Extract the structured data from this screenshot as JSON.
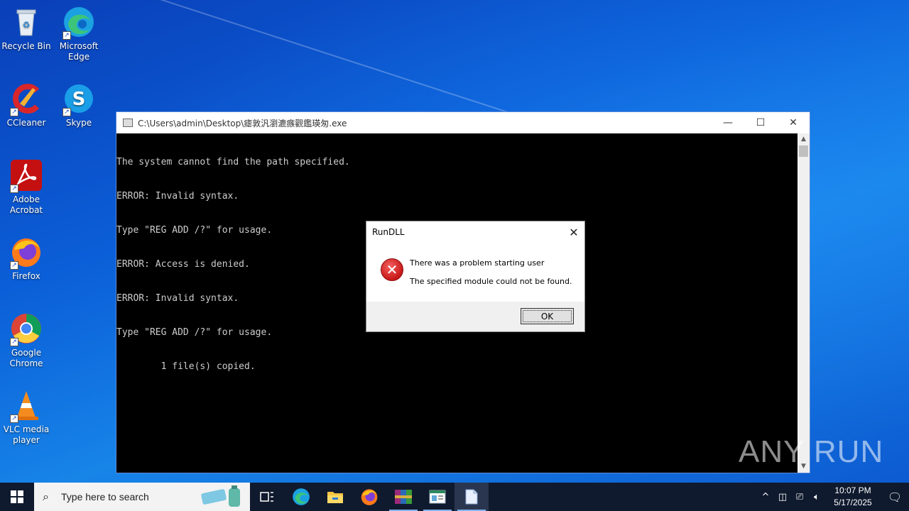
{
  "desktop": {
    "icons": [
      {
        "label": "Recycle Bin"
      },
      {
        "label": "Microsoft Edge"
      },
      {
        "label": "CCleaner"
      },
      {
        "label": "Skype"
      },
      {
        "label": "Adobe Acrobat"
      },
      {
        "label": "Firefox"
      },
      {
        "label": "Google Chrome"
      },
      {
        "label": "VLC media player"
      }
    ]
  },
  "console": {
    "title": "C:\\Users\\admin\\Desktop\\瘧敦汎瀏漉瘯觀鑑瑛匆.exe",
    "lines": [
      "The system cannot find the path specified.",
      "ERROR: Invalid syntax.",
      "Type \"REG ADD /?\" for usage.",
      "ERROR: Access is denied.",
      "ERROR: Invalid syntax.",
      "Type \"REG ADD /?\" for usage.",
      "        1 file(s) copied."
    ]
  },
  "dialog": {
    "title": "RunDLL",
    "message1": "There was a problem starting user",
    "message2": "The specified module could not be found.",
    "ok_label": "OK"
  },
  "watermark": "ANY RUN",
  "taskbar": {
    "search_placeholder": "Type here to search",
    "time": "10:07 PM",
    "date": "5/17/2025"
  }
}
